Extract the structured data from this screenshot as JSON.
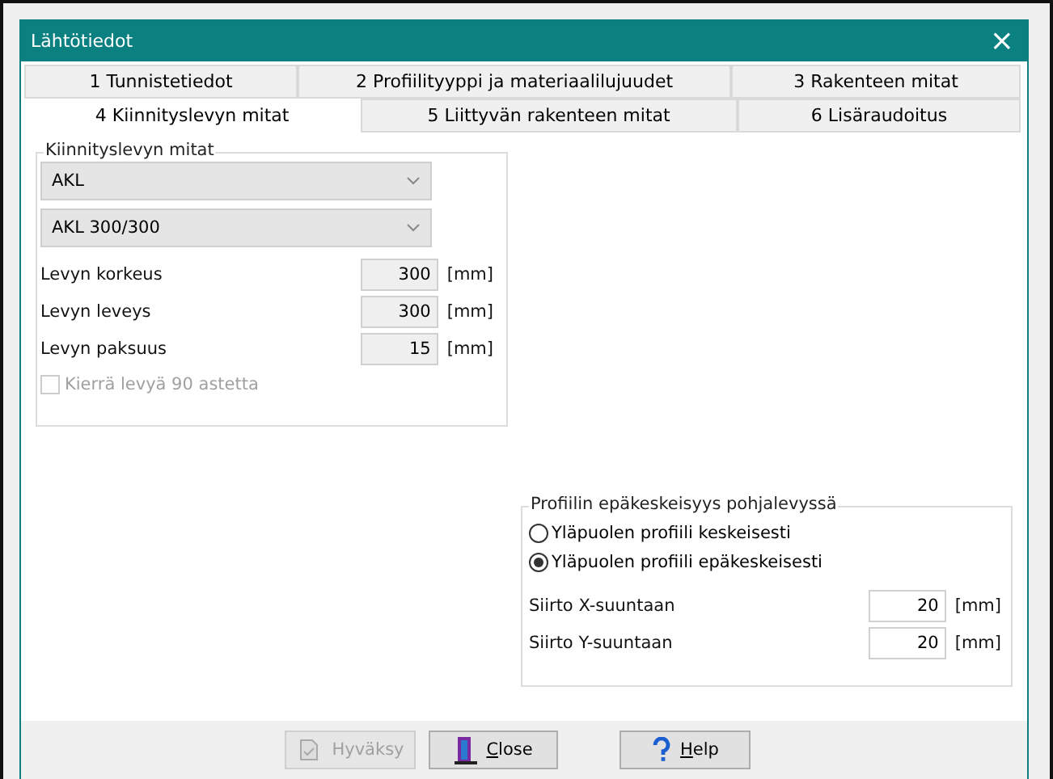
{
  "window": {
    "title": "Lähtötiedot",
    "close": "×"
  },
  "tab_rows": [
    [
      {
        "label": "1 Tunnistetiedot",
        "selected": false
      },
      {
        "label": "2 Profiilityyppi ja materiaalilujuudet",
        "selected": false
      },
      {
        "label": "3 Rakenteen mitat",
        "selected": false
      }
    ],
    [
      {
        "label": "4 Kiinnityslevyn mitat",
        "selected": true
      },
      {
        "label": "5 Liittyvän rakenteen mitat",
        "selected": false
      },
      {
        "label": "6 Lisäraudoitus",
        "selected": false
      }
    ]
  ],
  "plate_group": {
    "title": "Kiinnityslevyn mitat",
    "dropdowns": [
      "AKL",
      "AKL 300/300"
    ],
    "fields": [
      {
        "label": "Levyn korkeus",
        "value": "300",
        "unit": "[mm]"
      },
      {
        "label": "Levyn leveys",
        "value": "300",
        "unit": "[mm]"
      },
      {
        "label": "Levyn paksuus",
        "value": "15",
        "unit": "[mm]"
      }
    ],
    "checkbox": {
      "label": "Kierrä levyä 90 astetta",
      "checked": false,
      "disabled": true
    }
  },
  "eccentricity_group": {
    "title": "Profiilin epäkeskeisyys pohjalevyssä",
    "radios": [
      {
        "label": "Yläpuolen profiili keskeisesti",
        "selected": false
      },
      {
        "label": "Yläpuolen profiili epäkeskeisesti",
        "selected": true
      }
    ],
    "fields": [
      {
        "label": "Siirto X-suuntaan",
        "value": "20",
        "unit": "[mm]"
      },
      {
        "label": "Siirto Y-suuntaan",
        "value": "20",
        "unit": "[mm]"
      }
    ]
  },
  "buttons": [
    {
      "label": "Hyväksy",
      "kind": "accept",
      "disabled": true
    },
    {
      "label": "Close",
      "kind": "exit",
      "disabled": false
    },
    {
      "label": "Help",
      "kind": "help",
      "disabled": false
    }
  ]
}
